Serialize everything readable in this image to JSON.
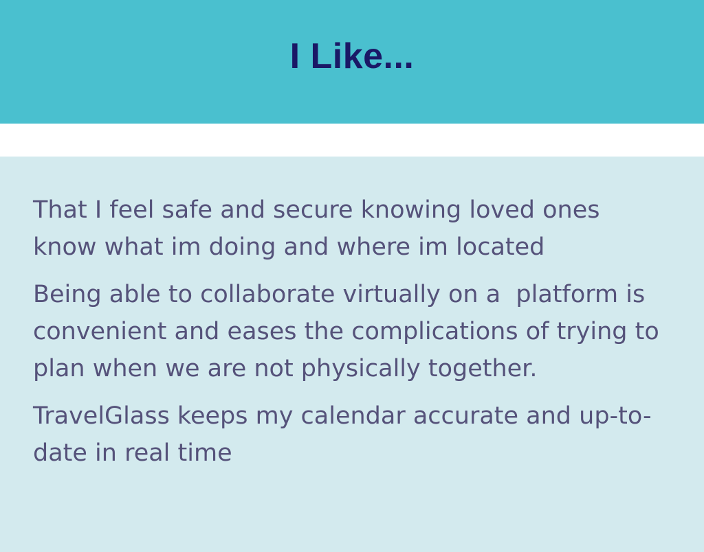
{
  "header": {
    "title": "I Like..."
  },
  "colors": {
    "header_background": "#4ac0cf",
    "title_text": "#1a1866",
    "content_background": "#d3eaee",
    "body_text": "#55527a"
  },
  "content": {
    "items": [
      {
        "text": "That I feel safe and secure knowing loved ones know what im doing and where im located"
      },
      {
        "text": "Being able to collaborate virtually on a  platform is convenient and eases the complications of trying to plan when we are not physically together."
      },
      {
        "text": "TravelGlass keeps my calendar accurate and up-to-date in real time"
      }
    ]
  }
}
